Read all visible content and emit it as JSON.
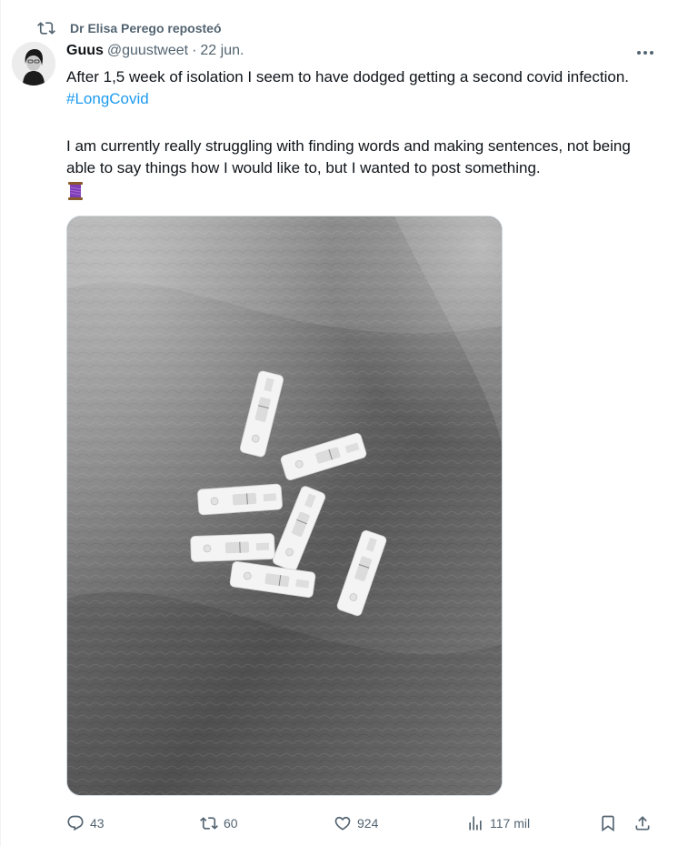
{
  "repost": {
    "text": "Dr Elisa Perego reposteó",
    "icon": "retweet-icon"
  },
  "tweet": {
    "author_name": "Guus",
    "handle": "@guustweet",
    "separator": "·",
    "date": "22 jun.",
    "text_line1": "After 1,5 week of isolation I seem to have dodged getting a second covid infection.",
    "hashtag": "#LongCovid",
    "text_para2": "I am currently really struggling with finding words and making sentences, not being able to say things how I would like to, but I wanted to post something.",
    "emoji": "thread-emoji"
  },
  "media": {
    "alt": "Several negative covid rapid antigen tests on a grey fuzzy blanket"
  },
  "actions": {
    "replies": "43",
    "reposts": "60",
    "likes": "924",
    "views": "117 mil"
  },
  "colors": {
    "accent": "#1d9bf0",
    "secondary_text": "#536471",
    "primary_text": "#0f1419"
  }
}
